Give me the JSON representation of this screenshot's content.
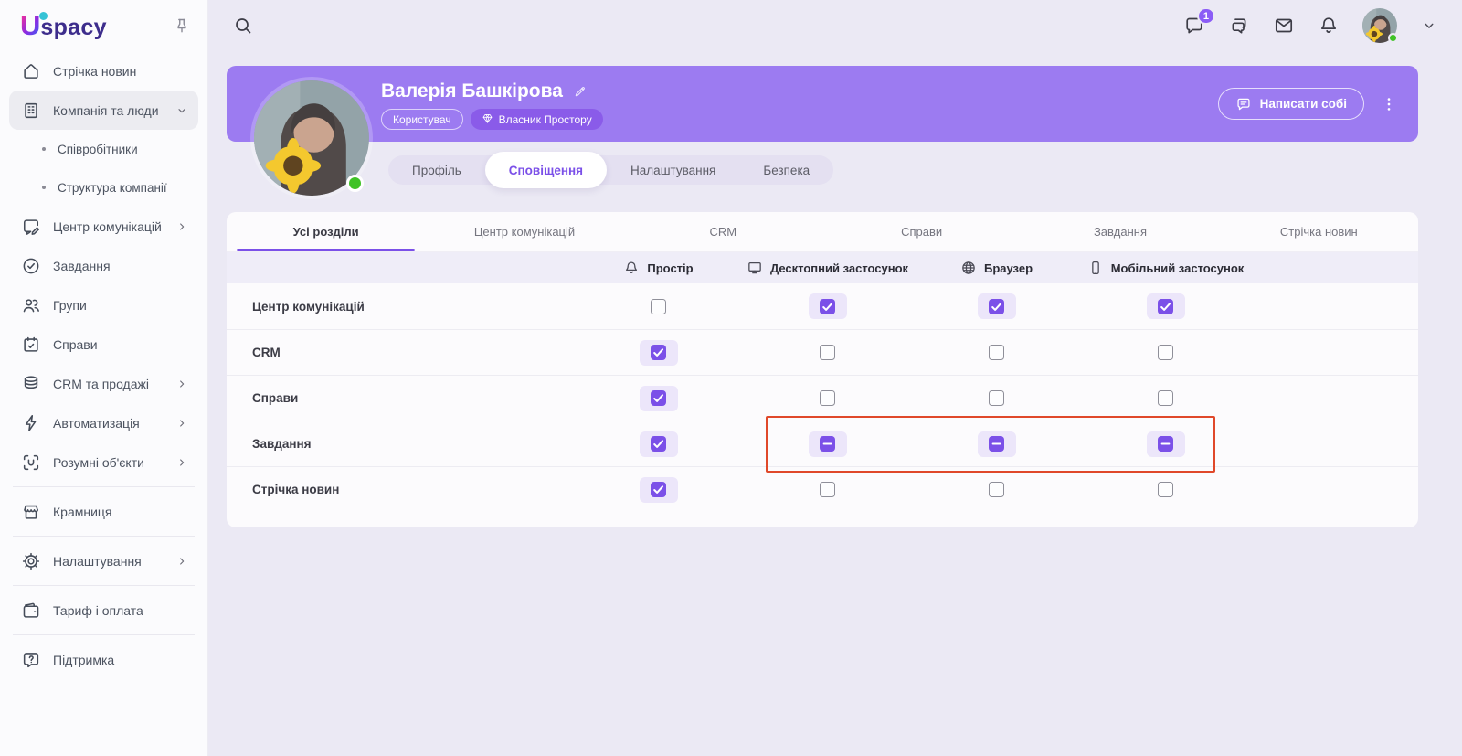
{
  "brand": {
    "initial": "U",
    "suffix": "spacy"
  },
  "topbar": {
    "chat_badge": "1"
  },
  "sidebar": {
    "items": [
      {
        "type": "item",
        "name": "newsfeed",
        "icon": "home",
        "label": "Стрічка новин"
      },
      {
        "type": "item",
        "name": "company-people",
        "icon": "building",
        "label": "Компанія та люди",
        "chevron": "down",
        "active": true
      },
      {
        "type": "sub",
        "name": "employees",
        "label": "Співробітники"
      },
      {
        "type": "sub",
        "name": "company-structure",
        "label": "Структура компанії"
      },
      {
        "type": "item",
        "name": "communication-center",
        "icon": "chat-edit",
        "label": "Центр комунікацій",
        "chevron": "right"
      },
      {
        "type": "item",
        "name": "tasks",
        "icon": "check-circle",
        "label": "Завдання"
      },
      {
        "type": "item",
        "name": "groups",
        "icon": "users",
        "label": "Групи"
      },
      {
        "type": "item",
        "name": "activities",
        "icon": "calendar",
        "label": "Справи"
      },
      {
        "type": "item",
        "name": "crm-sales",
        "icon": "database",
        "label": "CRM та продажі",
        "chevron": "right"
      },
      {
        "type": "item",
        "name": "automation",
        "icon": "bolt",
        "label": "Автоматизація",
        "chevron": "right"
      },
      {
        "type": "item",
        "name": "smart-objects",
        "icon": "scan",
        "label": "Розумні об'єкти",
        "chevron": "right"
      },
      {
        "type": "divider"
      },
      {
        "type": "item",
        "name": "marketplace",
        "icon": "store",
        "label": "Крамниця"
      },
      {
        "type": "divider"
      },
      {
        "type": "item",
        "name": "settings",
        "icon": "gear",
        "label": "Налаштування",
        "chevron": "right"
      },
      {
        "type": "divider"
      },
      {
        "type": "item",
        "name": "tariff-payment",
        "icon": "wallet",
        "label": "Тариф і оплата"
      },
      {
        "type": "divider"
      },
      {
        "type": "item",
        "name": "support",
        "icon": "help",
        "label": "Підтримка"
      }
    ]
  },
  "profile": {
    "name": "Валерія Башкірова",
    "message_button": "Написати собі",
    "badges": [
      {
        "name": "user-role",
        "label": "Користувач",
        "style": "outline"
      },
      {
        "name": "owner-role",
        "label": "Власник Простору",
        "style": "solid",
        "icon": "diamond"
      }
    ],
    "tabs": [
      {
        "name": "profile",
        "label": "Профіль"
      },
      {
        "name": "notifications",
        "label": "Сповіщення",
        "active": true
      },
      {
        "name": "settings",
        "label": "Налаштування"
      },
      {
        "name": "security",
        "label": "Безпека"
      }
    ]
  },
  "notifications": {
    "section_tabs": [
      {
        "name": "all-sections",
        "label": "Усі розділи",
        "active": true
      },
      {
        "name": "communication-center",
        "label": "Центр комунікацій"
      },
      {
        "name": "crm",
        "label": "CRM"
      },
      {
        "name": "activities",
        "label": "Справи"
      },
      {
        "name": "tasks",
        "label": "Завдання"
      },
      {
        "name": "newsfeed",
        "label": "Стрічка новин"
      }
    ],
    "columns": [
      {
        "key": "space",
        "icon": "bell",
        "label": "Простір"
      },
      {
        "key": "desktop",
        "icon": "monitor",
        "label": "Десктопний застосунок"
      },
      {
        "key": "browser",
        "icon": "globe",
        "label": "Браузер"
      },
      {
        "key": "mobile",
        "icon": "phone",
        "label": "Мобільний застосунок"
      }
    ],
    "rows": [
      {
        "name": "communication-center",
        "label": "Центр комунікацій",
        "states": [
          "unchecked",
          "checked",
          "checked",
          "checked"
        ]
      },
      {
        "name": "crm",
        "label": "CRM",
        "states": [
          "checked",
          "unchecked",
          "unchecked",
          "unchecked"
        ]
      },
      {
        "name": "activities",
        "label": "Справи",
        "states": [
          "checked",
          "unchecked",
          "unchecked",
          "unchecked"
        ]
      },
      {
        "name": "tasks",
        "label": "Завдання",
        "states": [
          "checked",
          "indeterminate",
          "indeterminate",
          "indeterminate"
        ],
        "highlighted": true
      },
      {
        "name": "newsfeed",
        "label": "Стрічка новин",
        "states": [
          "checked",
          "unchecked",
          "unchecked",
          "unchecked"
        ]
      }
    ]
  },
  "colors": {
    "accent": "#7b50e8",
    "banner": "#9c7bf1",
    "owner_badge": "#8a5be9",
    "highlight": "#e0482a",
    "online": "#3fc226",
    "badge": "#8b5cf6",
    "logo_dot": "#35c3d6"
  }
}
